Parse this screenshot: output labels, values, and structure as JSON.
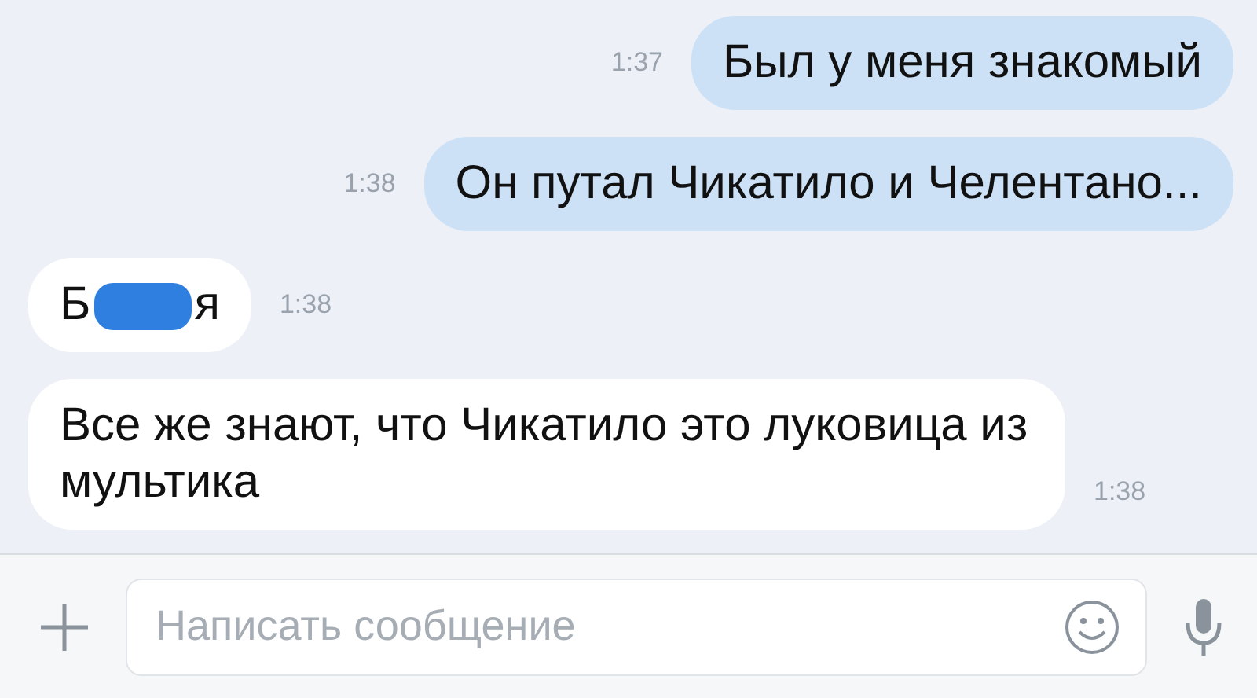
{
  "messages": [
    {
      "kind": "text",
      "outgoing": true,
      "text": "Был у меня знакомый",
      "time": "1:37"
    },
    {
      "kind": "text",
      "outgoing": true,
      "text": "Он путал Чикатило и Челентано...",
      "time": "1:38"
    },
    {
      "kind": "redacted",
      "outgoing": false,
      "text_start": "Б",
      "text_end": "я",
      "time": "1:38"
    },
    {
      "kind": "text",
      "outgoing": false,
      "text": "Все же знают, что Чикатило это луковица из мультика",
      "time": "1:38"
    }
  ],
  "composer": {
    "placeholder": "Написать сообщение"
  }
}
